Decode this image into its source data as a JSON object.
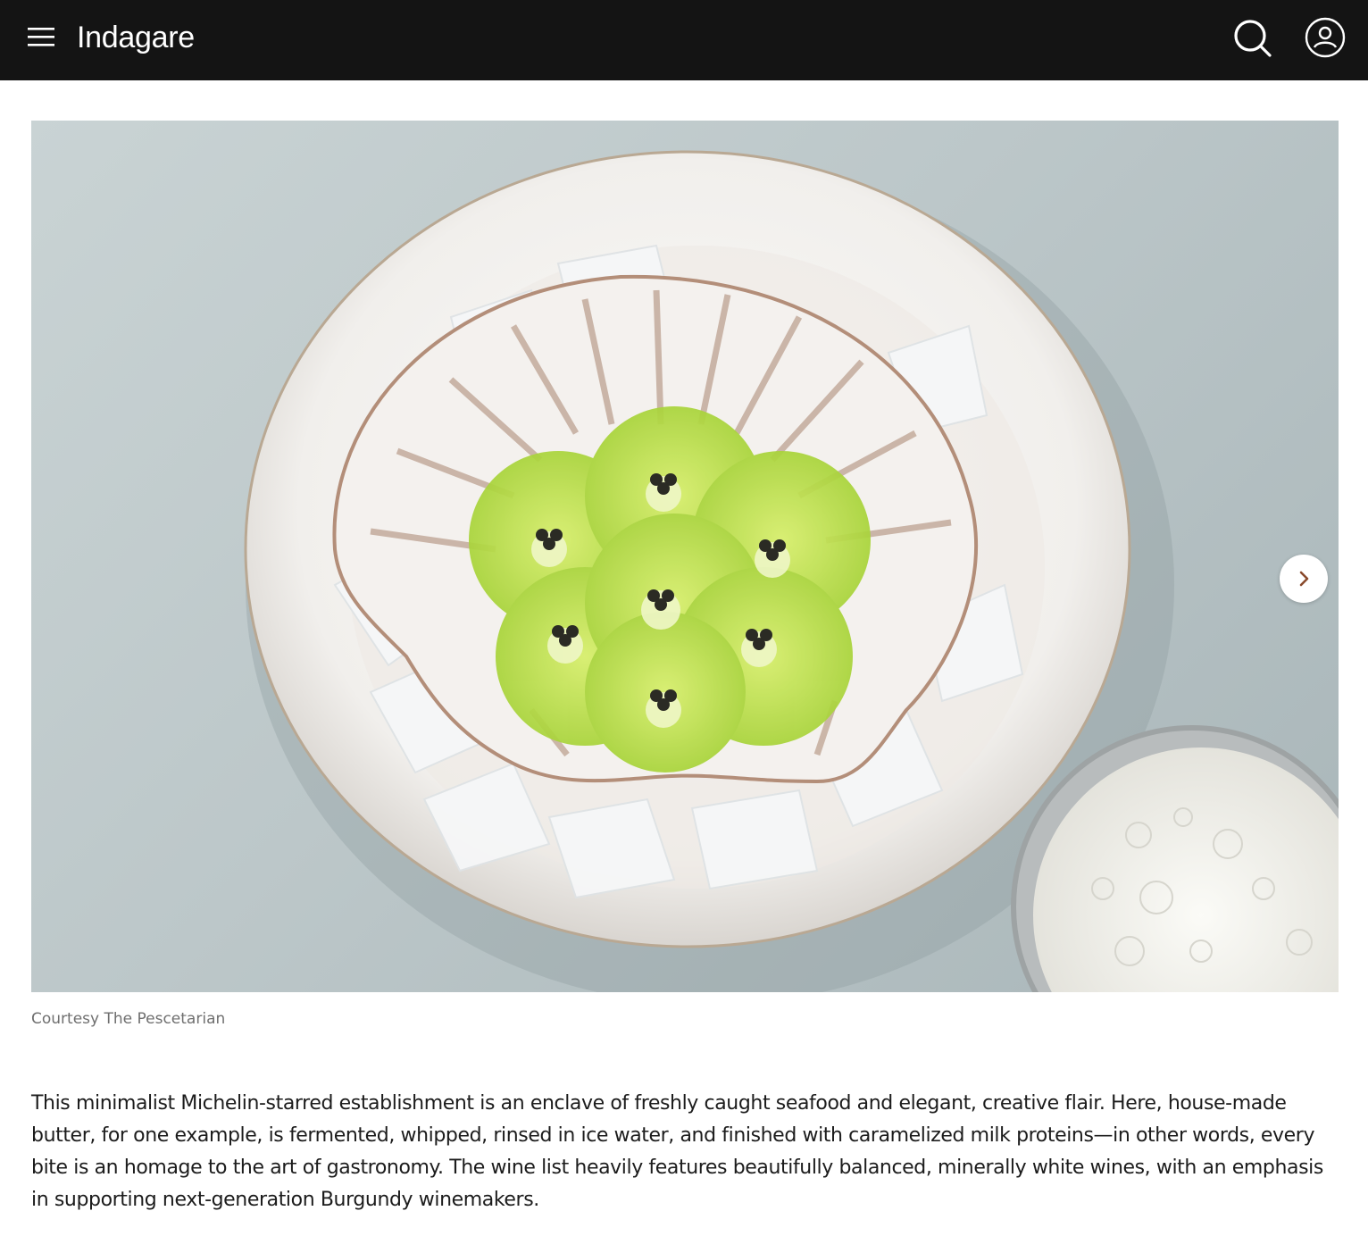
{
  "header": {
    "brand": "Indagare",
    "menu_icon": "hamburger-menu-icon",
    "search_icon": "search-icon",
    "account_icon": "user-account-icon",
    "background": "#141414"
  },
  "gallery": {
    "image_alt": "Scallop shell on ice with green gel discs and caviar",
    "next_icon": "chevron-right-icon",
    "caption": "Courtesy The Pescetarian"
  },
  "article": {
    "paragraph": "This minimalist Michelin-starred establishment is an enclave of freshly caught seafood and elegant, creative flair. Here, house-made butter, for one example, is fermented, whipped, rinsed in ice water, and finished with caramelized milk proteins—in other words, every bite is an homage to the art of gastronomy. The wine list heavily features beautifully balanced, minerally white wines, with an emphasis in supporting next-generation Burgundy winemakers."
  }
}
